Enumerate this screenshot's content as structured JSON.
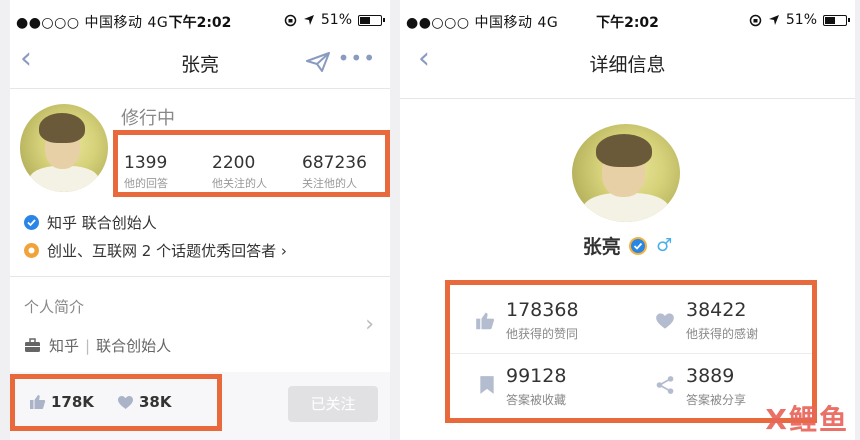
{
  "status_bar": {
    "carrier": "●●○○○ 中国移动   4G",
    "time": "下午2:02",
    "battery_text": "51%",
    "battery_level": 0.51
  },
  "left": {
    "nav": {
      "title": "张亮",
      "back_icon": "chevron-left-icon",
      "share_icon": "paper-plane-icon",
      "more_icon": "more-dots-icon",
      "more_text": "•••"
    },
    "tagline": "修行中",
    "stats": [
      {
        "num": "1399",
        "label": "他的回答"
      },
      {
        "num": "2200",
        "label": "他关注的人"
      },
      {
        "num": "687236",
        "label": "关注他的人"
      }
    ],
    "badges": [
      {
        "text": "知乎 联合创始人",
        "icon": "verified-icon",
        "color": "#2a86e6"
      },
      {
        "text": "创业、互联网 2 个话题优秀回答者 ›",
        "icon": "star-badge-icon",
        "color": "#f0a33a"
      }
    ],
    "section_label": "个人简介",
    "company": {
      "name": "知乎",
      "separator": "|",
      "title": "联合创始人"
    },
    "votes": {
      "upvotes": "178K",
      "thanks": "38K"
    },
    "follow_button": "已关注"
  },
  "right": {
    "nav": {
      "title": "详细信息"
    },
    "name": "张亮",
    "gender_symbol": "♂",
    "stats": [
      {
        "num": "178368",
        "label": "他获得的赞同",
        "icon": "thumbs-up-icon"
      },
      {
        "num": "38422",
        "label": "他获得的感谢",
        "icon": "heart-icon"
      },
      {
        "num": "99128",
        "label": "答案被收藏",
        "icon": "bookmark-icon"
      },
      {
        "num": "3889",
        "label": "答案被分享",
        "icon": "share-icon"
      }
    ]
  },
  "watermark": "X鲤鱼",
  "colors": {
    "accent_nav": "#8a9bc0",
    "highlight_border": "#e86a3c",
    "verified_blue": "#2a86e6"
  }
}
